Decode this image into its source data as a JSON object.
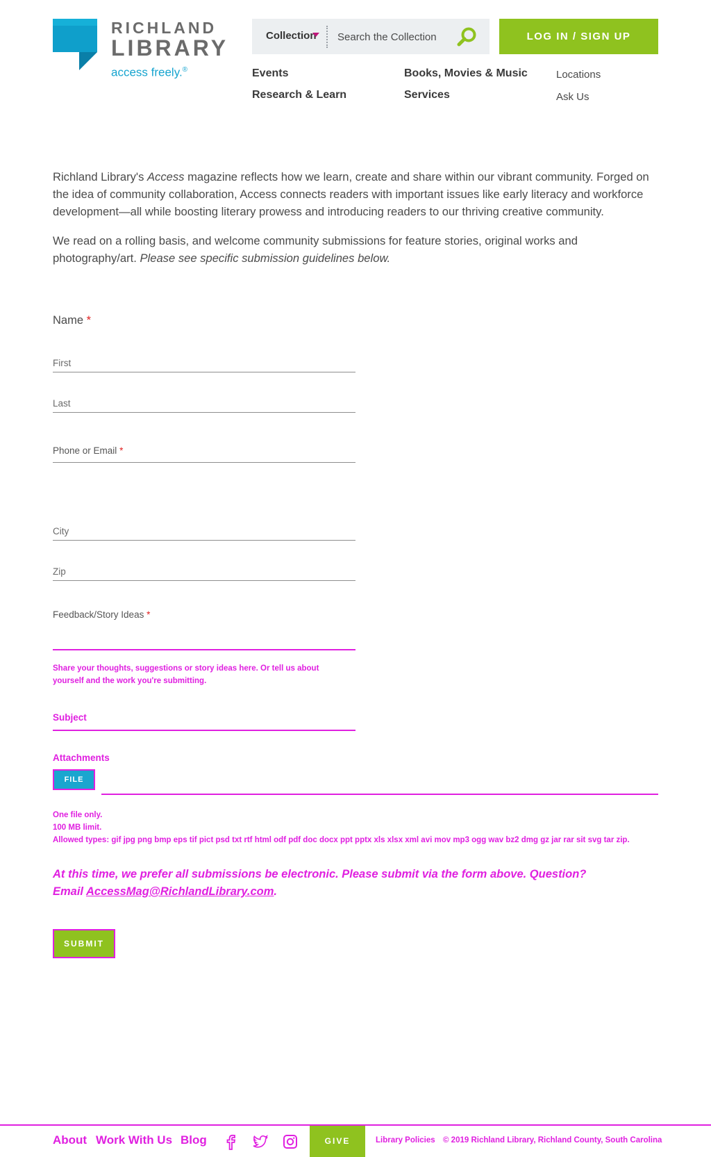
{
  "header": {
    "logo": {
      "line1": "RICHLAND",
      "line2": "LIBRARY",
      "tagline": "access freely.",
      "tagline_mark": "®"
    },
    "search": {
      "scope": "Collection",
      "placeholder": "Search the Collection",
      "icon": "search-icon"
    },
    "login_label": "LOG IN / SIGN UP",
    "nav": {
      "events": "Events",
      "books": "Books, Movies & Music",
      "locations": "Locations",
      "research": "Research & Learn",
      "services": "Services",
      "ask": "Ask Us"
    }
  },
  "intro": {
    "p1_before": "Richland Library's ",
    "p1_em": "Access",
    "p1_after": " magazine reflects how we learn, create and share within our vibrant community. Forged on the idea of community collaboration, Access connects readers with important issues like early literacy and workforce development—all while boosting literary prowess and introducing readers to our thriving creative community.",
    "p2_before": "We read on a rolling basis, and welcome community submissions for feature stories, original works and photography/art. ",
    "p2_em": "Please see specific submission guidelines below."
  },
  "form": {
    "name_label": "Name",
    "required_mark": "*",
    "first_placeholder": "First",
    "last_placeholder": "Last",
    "contact_label": "Phone or Email",
    "city_placeholder": "City",
    "zip_placeholder": "Zip",
    "feedback_label": "Feedback/Story Ideas",
    "feedback_help": "Share your thoughts, suggestions or story ideas here. Or tell us about yourself and the work you're submitting.",
    "subject_label": "Subject",
    "attachments_label": "Attachments",
    "file_button": "FILE",
    "note_one": "One file only.",
    "note_limit": "100 MB limit.",
    "note_types": "Allowed types: gif jpg png bmp eps tif pict psd txt rtf html odf pdf doc docx ppt pptx xls xlsx xml avi mov mp3 ogg wav bz2 dmg gz jar rar sit svg tar zip.",
    "prefer_text": "At this time, we prefer all submissions be electronic. Please submit via the form above. Question? Email ",
    "prefer_email": "AccessMag@RichlandLibrary.com",
    "prefer_end": ".",
    "submit_label": "SUBMIT"
  },
  "footer": {
    "about": "About",
    "work": "Work With Us",
    "blog": "Blog",
    "give": "GIVE",
    "policies": "Library Policies",
    "copyright": "© 2019 Richland Library, Richland County, South Carolina"
  },
  "colors": {
    "brand_green": "#8fc21f",
    "brand_blue": "#16a4cf",
    "required_red": "#e02020",
    "overlay_magenta": "#e020e0"
  }
}
